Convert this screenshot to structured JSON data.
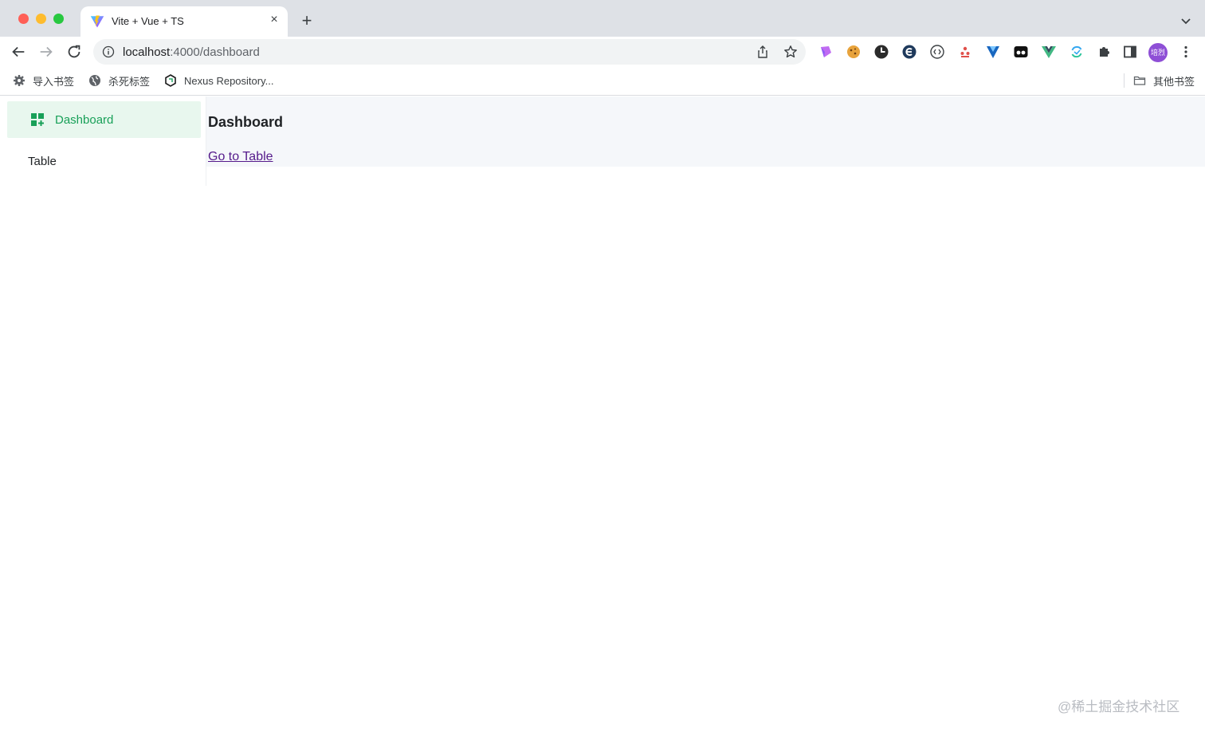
{
  "browser": {
    "tab": {
      "title": "Vite + Vue + TS",
      "close_glyph": "×"
    },
    "new_tab_glyph": "+",
    "omnibox": {
      "host": "localhost",
      "path": ":4000/dashboard"
    },
    "avatar_text": "培烈",
    "extensions": [
      "palette-icon",
      "cookie-icon",
      "clock-icon",
      "edge-icon",
      "code-brackets-icon",
      "people-icon",
      "vuetify-icon",
      "record-icon",
      "vue-devtools-icon",
      "sync-icon",
      "puzzle-icon",
      "side-panel-icon"
    ],
    "bookmarks": [
      {
        "label": "导入书签",
        "icon": "gear-icon"
      },
      {
        "label": "杀死标签",
        "icon": "globe-icon"
      },
      {
        "label": "Nexus Repository...",
        "icon": "hexagon-icon"
      }
    ],
    "other_bookmarks": "其他书签"
  },
  "sidebar": {
    "items": [
      {
        "label": "Dashboard",
        "active": true,
        "icon": "dashboard-icon"
      },
      {
        "label": "Table",
        "active": false
      }
    ]
  },
  "main": {
    "title": "Dashboard",
    "link_label": "Go to Table"
  },
  "watermark": "@稀土掘金技术社区",
  "colors": {
    "accent": "#18a058",
    "accent_bg": "#e8f7ee",
    "visited_link": "#551a8b",
    "main_bg": "#f5f7fa"
  }
}
